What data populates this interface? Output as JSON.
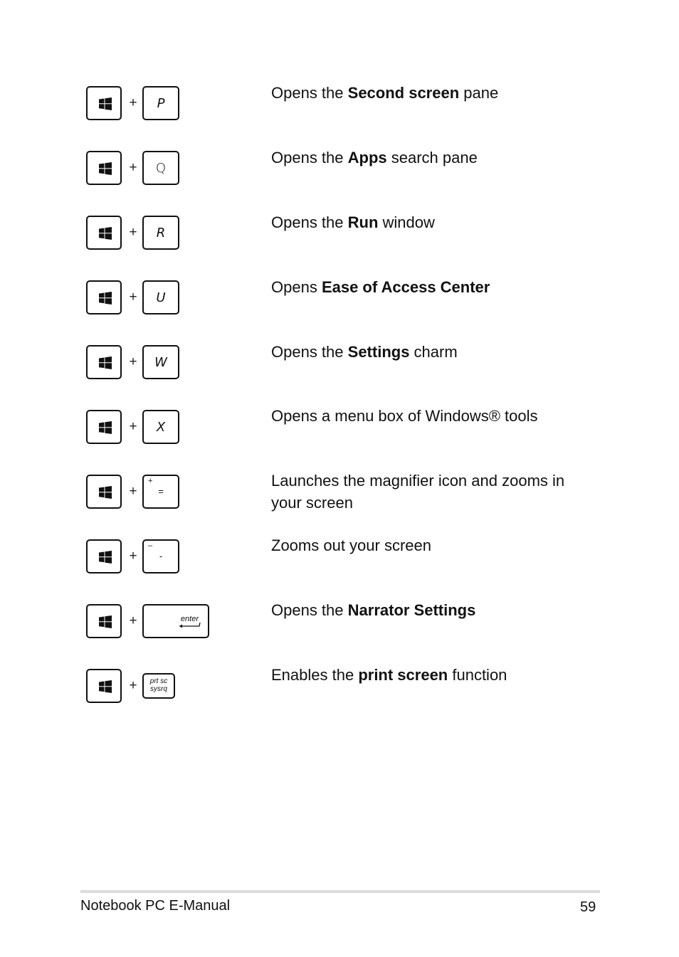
{
  "shortcuts": [
    {
      "key": "P",
      "desc_pre": "Opens the ",
      "desc_bold": "Second screen",
      "desc_post": " pane"
    },
    {
      "key": "Q",
      "desc_pre": "Opens the ",
      "desc_bold": "Apps",
      "desc_post": " search pane"
    },
    {
      "key": "R",
      "desc_pre": "Opens the ",
      "desc_bold": "Run",
      "desc_post": " window"
    },
    {
      "key": "U",
      "desc_pre": "Opens ",
      "desc_bold": "Ease of Access Center",
      "desc_post": ""
    },
    {
      "key": "W",
      "desc_pre": "Opens the ",
      "desc_bold": "Settings",
      "desc_post": " charm"
    },
    {
      "key": "X",
      "desc_pre": "Opens a menu box of Windows® tools",
      "desc_bold": "",
      "desc_post": ""
    },
    {
      "key_top": "+",
      "key_main": "=",
      "desc_pre": "Launches the magnifier icon and zooms in your screen",
      "desc_bold": "",
      "desc_post": ""
    },
    {
      "key_top": "–",
      "key_main": "-",
      "desc_pre": "Zooms out your screen",
      "desc_bold": "",
      "desc_post": ""
    },
    {
      "key": "enter",
      "desc_pre": "Opens the ",
      "desc_bold": "Narrator Settings",
      "desc_post": ""
    },
    {
      "key_line1": "prt sc",
      "key_line2": "sysrq",
      "desc_pre": "Enables the ",
      "desc_bold": "print screen",
      "desc_post": " function"
    }
  ],
  "plus_sign": "+",
  "modifier_icon": "windows-logo-icon",
  "footer": {
    "title": "Notebook PC E-Manual",
    "page_number": "59"
  }
}
